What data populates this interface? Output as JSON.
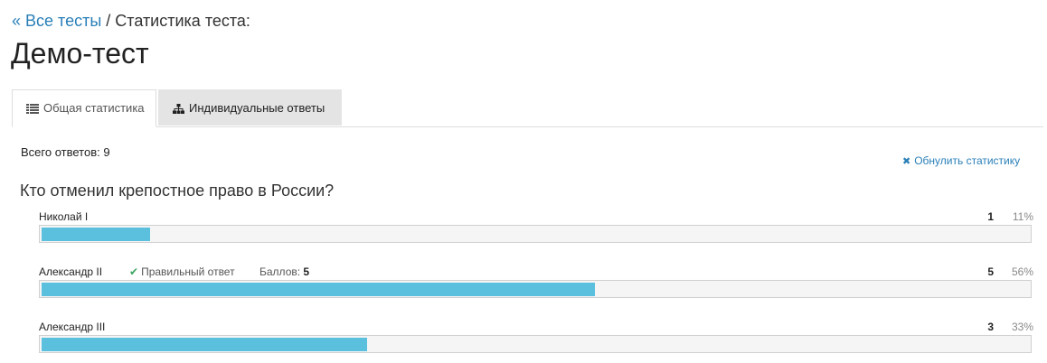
{
  "breadcrumb": {
    "back_label": "« Все тесты",
    "separator": " / ",
    "current": "Статистика теста:"
  },
  "page_title": "Демо-тест",
  "tabs": [
    {
      "label": "Общая статистика",
      "icon": "list-icon",
      "active": true
    },
    {
      "label": "Индивидуальные ответы",
      "icon": "sitemap-icon",
      "active": false
    }
  ],
  "summary": {
    "total_label": "Всего ответов: 9"
  },
  "reset_button": {
    "label": "Обнулить статистику",
    "icon": "close-icon"
  },
  "question": {
    "text": "Кто отменил крепостное право в России?",
    "answers": [
      {
        "label": "Николай I",
        "count": "1",
        "percent": "11%",
        "fraction": 0.11,
        "correct": false
      },
      {
        "label": "Александр II",
        "count": "5",
        "percent": "56%",
        "fraction": 0.56,
        "correct": true,
        "correct_label": "Правильный ответ",
        "score_label": "Баллов:",
        "score_value": "5"
      },
      {
        "label": "Александр III",
        "count": "3",
        "percent": "33%",
        "fraction": 0.33,
        "correct": false
      }
    ]
  },
  "colors": {
    "link": "#2a7fb8",
    "bar_fill": "#5bc0de",
    "correct_check": "#3aa55f"
  }
}
